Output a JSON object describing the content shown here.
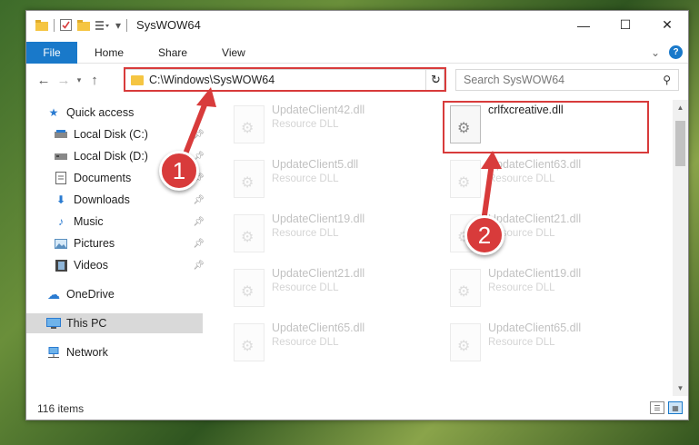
{
  "window": {
    "title": "SysWOW64",
    "controls": {
      "minimize": "—",
      "maximize": "☐",
      "close": "✕"
    }
  },
  "ribbon": {
    "file_tab": "File",
    "tabs": [
      "Home",
      "Share",
      "View"
    ],
    "help": "?"
  },
  "nav": {
    "address_path": "C:\\Windows\\SysWOW64",
    "search_placeholder": "Search SysWOW64"
  },
  "sidebar": {
    "items": [
      {
        "label": "Quick access",
        "icon": "star-icon"
      },
      {
        "label": "Local Disk (C:)",
        "icon": "drive-icon"
      },
      {
        "label": "Local Disk (D:)",
        "icon": "drive-icon"
      },
      {
        "label": "Documents",
        "icon": "documents-icon"
      },
      {
        "label": "Downloads",
        "icon": "download-icon"
      },
      {
        "label": "Music",
        "icon": "music-icon"
      },
      {
        "label": "Pictures",
        "icon": "pictures-icon"
      },
      {
        "label": "Videos",
        "icon": "videos-icon"
      },
      {
        "label": "OneDrive",
        "icon": "cloud-icon"
      },
      {
        "label": "This PC",
        "icon": "pc-icon"
      },
      {
        "label": "Network",
        "icon": "network-icon"
      }
    ]
  },
  "files": [
    {
      "name": "UpdateClient42.dll",
      "desc": "Resource DLL"
    },
    {
      "name": "crlfxcreative.dll",
      "desc": ""
    },
    {
      "name": "UpdateClient5.dll",
      "desc": "Resource DLL"
    },
    {
      "name": "UpdateClient63.dll",
      "desc": "Resource DLL"
    },
    {
      "name": "UpdateClient19.dll",
      "desc": "Resource DLL"
    },
    {
      "name": "UpdateClient21.dll",
      "desc": "Resource DLL"
    },
    {
      "name": "UpdateClient21.dll",
      "desc": "Resource DLL"
    },
    {
      "name": "UpdateClient19.dll",
      "desc": "Resource DLL"
    },
    {
      "name": "UpdateClient65.dll",
      "desc": "Resource DLL"
    },
    {
      "name": "UpdateClient65.dll",
      "desc": "Resource DLL"
    }
  ],
  "status": {
    "item_count": "116 items"
  },
  "callouts": {
    "step1": "1",
    "step2": "2"
  },
  "colors": {
    "accent": "#1979ca",
    "highlight": "#d83b3b",
    "selection": "#d9d9d9"
  }
}
